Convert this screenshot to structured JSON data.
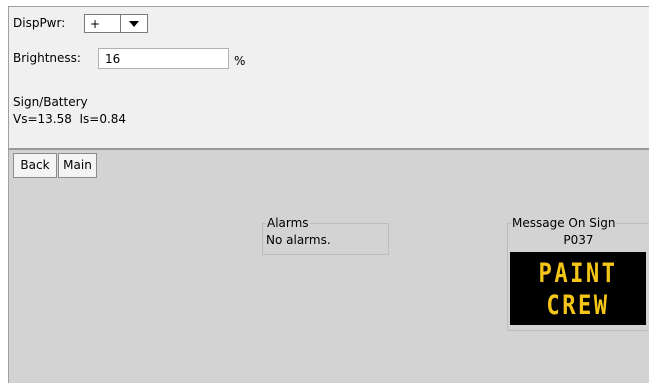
{
  "display_power": {
    "label": "DispPwr:",
    "selected": "+"
  },
  "brightness": {
    "label": "Brightness:",
    "value": "16",
    "unit": "%"
  },
  "sign_battery": {
    "title": "Sign/Battery",
    "readout": "Vs=13.58  Is=0.84"
  },
  "nav": {
    "back_label": "Back",
    "main_label": "Main"
  },
  "alarms": {
    "title": "Alarms",
    "text": "No alarms."
  },
  "message_on_sign": {
    "title": "Message On Sign",
    "code": "P037",
    "lines": [
      "PAINT",
      "CREW"
    ],
    "text_color": "#f5c518",
    "board_color": "#000000"
  }
}
